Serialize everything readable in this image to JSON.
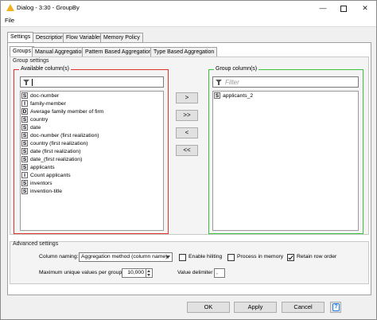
{
  "window": {
    "title": "Dialog - 3:30 - GroupBy",
    "minimize": "—",
    "close": "✕"
  },
  "menu": {
    "file": "File"
  },
  "outer_tabs": [
    "Settings",
    "Description",
    "Flow Variables",
    "Memory Policy"
  ],
  "inner_tabs": [
    "Groups",
    "Manual Aggregation",
    "Pattern Based Aggregation",
    "Type Based Aggregation"
  ],
  "group_settings": {
    "title": "Group settings",
    "available": {
      "title": "Available column(s)",
      "filter_value": "",
      "items": [
        {
          "type": "S",
          "label": "doc-number"
        },
        {
          "type": "I",
          "label": "family-member"
        },
        {
          "type": "D",
          "label": "Average family member of firm"
        },
        {
          "type": "S",
          "label": "country"
        },
        {
          "type": "S",
          "label": "date"
        },
        {
          "type": "S",
          "label": "doc-number (first realization)"
        },
        {
          "type": "S",
          "label": "country (first realization)"
        },
        {
          "type": "S",
          "label": "date (first realization)"
        },
        {
          "type": "S",
          "label": "date_(first realization)"
        },
        {
          "type": "S",
          "label": "applicants"
        },
        {
          "type": "I",
          "label": "Count applicants"
        },
        {
          "type": "S",
          "label": "inventors"
        },
        {
          "type": "S",
          "label": "invention-title"
        }
      ]
    },
    "group": {
      "title": "Group column(s)",
      "filter_placeholder": "Filter",
      "items": [
        {
          "type": "S",
          "label": "applicants_2"
        }
      ]
    },
    "move_buttons": [
      ">",
      ">>",
      "<",
      "<<"
    ]
  },
  "advanced": {
    "title": "Advanced settings",
    "column_naming_label": "Column naming:",
    "column_naming_value": "Aggregation method (column name)",
    "enable_hiliting": {
      "label": "Enable hiliting",
      "checked": false
    },
    "process_in_memory": {
      "label": "Process in memory",
      "checked": false
    },
    "retain_row_order": {
      "label": "Retain row order",
      "checked": true
    },
    "max_unique_label": "Maximum unique values per group",
    "max_unique_value": "10,000",
    "value_delimiter_label": "Value delimiter",
    "value_delimiter_value": ","
  },
  "buttons": {
    "ok": "OK",
    "apply": "Apply",
    "cancel": "Cancel",
    "help": "?"
  },
  "colors": {
    "available_border": "#e0322c",
    "group_border": "#3cc23c",
    "help_accent": "#2a7de1"
  }
}
